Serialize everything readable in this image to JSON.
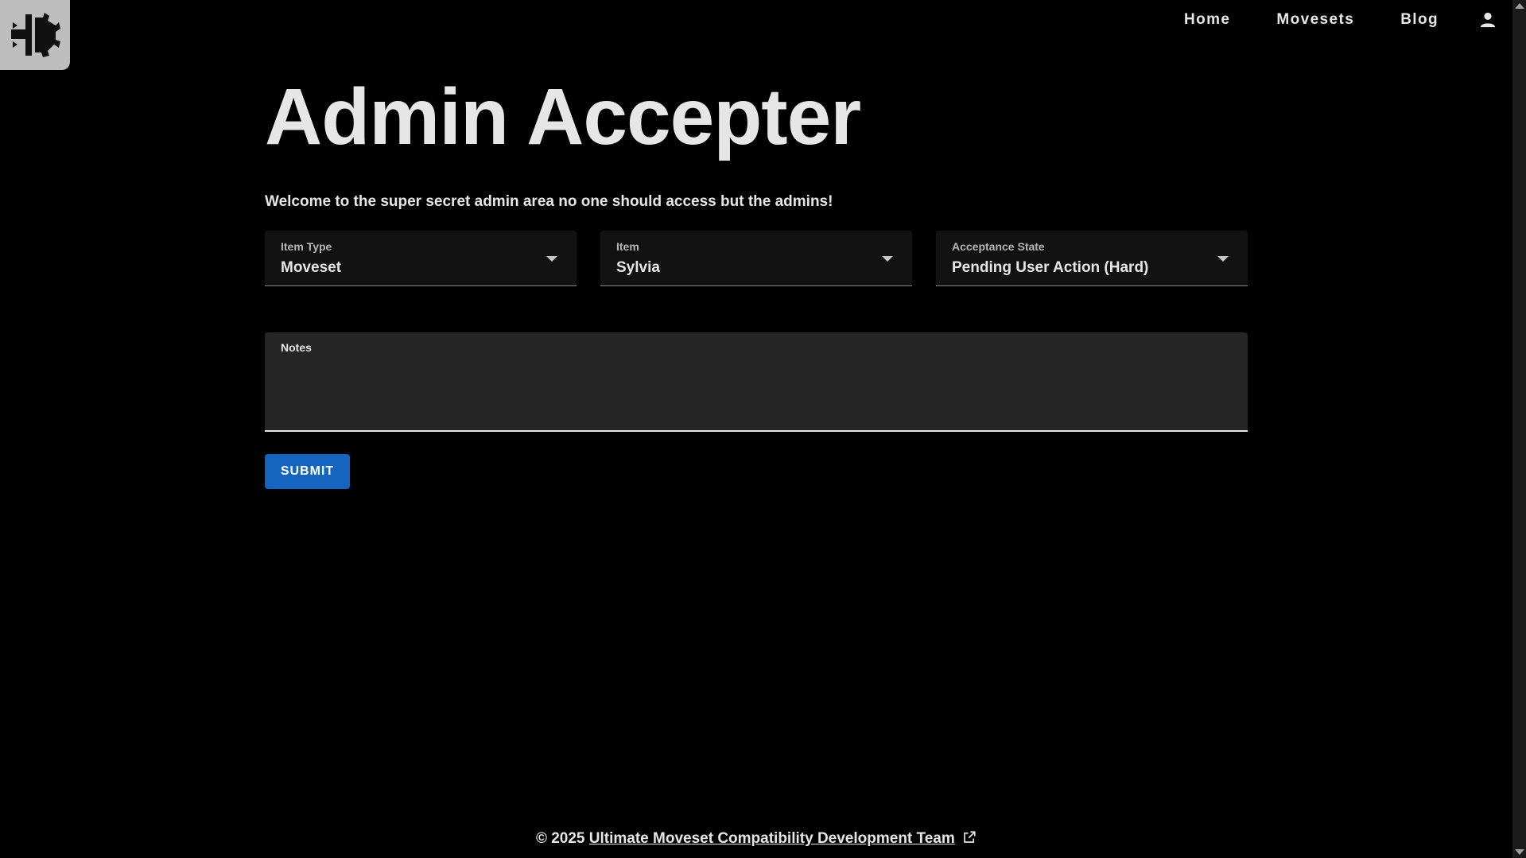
{
  "colors": {
    "background": "#000000",
    "text": "#e6e6e6",
    "select_bg": "#121212",
    "notes_bg": "#262626",
    "submit_bg": "#1565c0",
    "logo_bg": "#bdbdbd"
  },
  "logo": {
    "icon": "site-logo-icon"
  },
  "nav": {
    "items": [
      {
        "label": "Home"
      },
      {
        "label": "Movesets"
      },
      {
        "label": "Blog"
      }
    ],
    "user_icon": "person-icon"
  },
  "page": {
    "title": "Admin Accepter",
    "welcome": "Welcome to the super secret admin area no one should access but the admins!"
  },
  "form": {
    "selects": [
      {
        "label": "Item Type",
        "value": "Moveset"
      },
      {
        "label": "Item",
        "value": "Sylvia"
      },
      {
        "label": "Acceptance State",
        "value": "Pending User Action (Hard)"
      }
    ],
    "notes": {
      "label": "Notes",
      "value": ""
    },
    "submit_label": "SUBMIT"
  },
  "footer": {
    "copyright": "© 2025",
    "link_text": "Ultimate Moveset Compatibility Development Team",
    "link_icon": "open-in-new-icon"
  }
}
